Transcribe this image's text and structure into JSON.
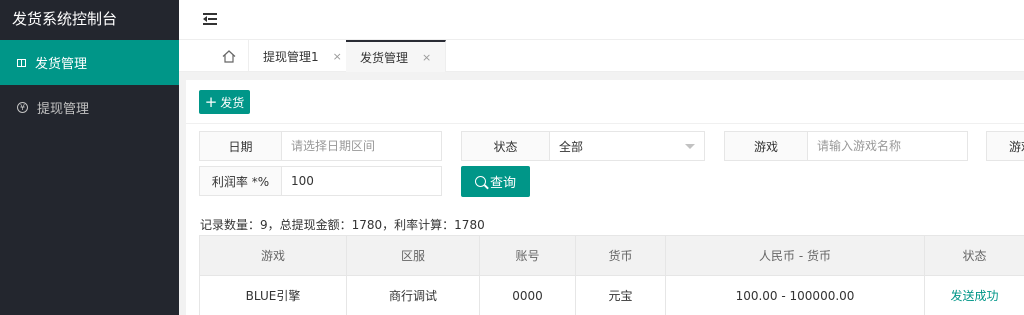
{
  "app": {
    "title": "发货系统控制台"
  },
  "sidebar": {
    "items": [
      {
        "label": "发货管理",
        "icon": "gift-icon",
        "active": true
      },
      {
        "label": "提现管理",
        "icon": "yen-icon",
        "active": false
      }
    ]
  },
  "header": {
    "menu_icon": "menu-fold-icon"
  },
  "tabs": [
    {
      "label": "提现管理1",
      "close": "×",
      "active": false
    },
    {
      "label": "发货管理",
      "close": "×",
      "active": true
    }
  ],
  "toolbar": {
    "add_label": "发货",
    "add_icon": "+"
  },
  "filters": {
    "date": {
      "label": "日期",
      "placeholder": "请选择日期区间"
    },
    "status": {
      "label": "状态",
      "value": "全部"
    },
    "game": {
      "label": "游戏",
      "placeholder": "请输入游戏名称"
    },
    "extra": {
      "label": "游戏"
    },
    "profit": {
      "label": "利润率 *%",
      "value": "100"
    },
    "search_label": "查询"
  },
  "summary": "记录数量：9，总提现金额：1780，利率计算：1780",
  "table": {
    "headers": [
      "游戏",
      "区服",
      "账号",
      "货币",
      "人民币 - 货币",
      "状态"
    ],
    "rows": [
      [
        "BLUE引擎",
        "商行调试",
        "0000",
        "元宝",
        "100.00 - 100000.00",
        "发送成功"
      ]
    ]
  },
  "colors": {
    "accent": "#009688",
    "sidebar_bg": "#23262e"
  }
}
